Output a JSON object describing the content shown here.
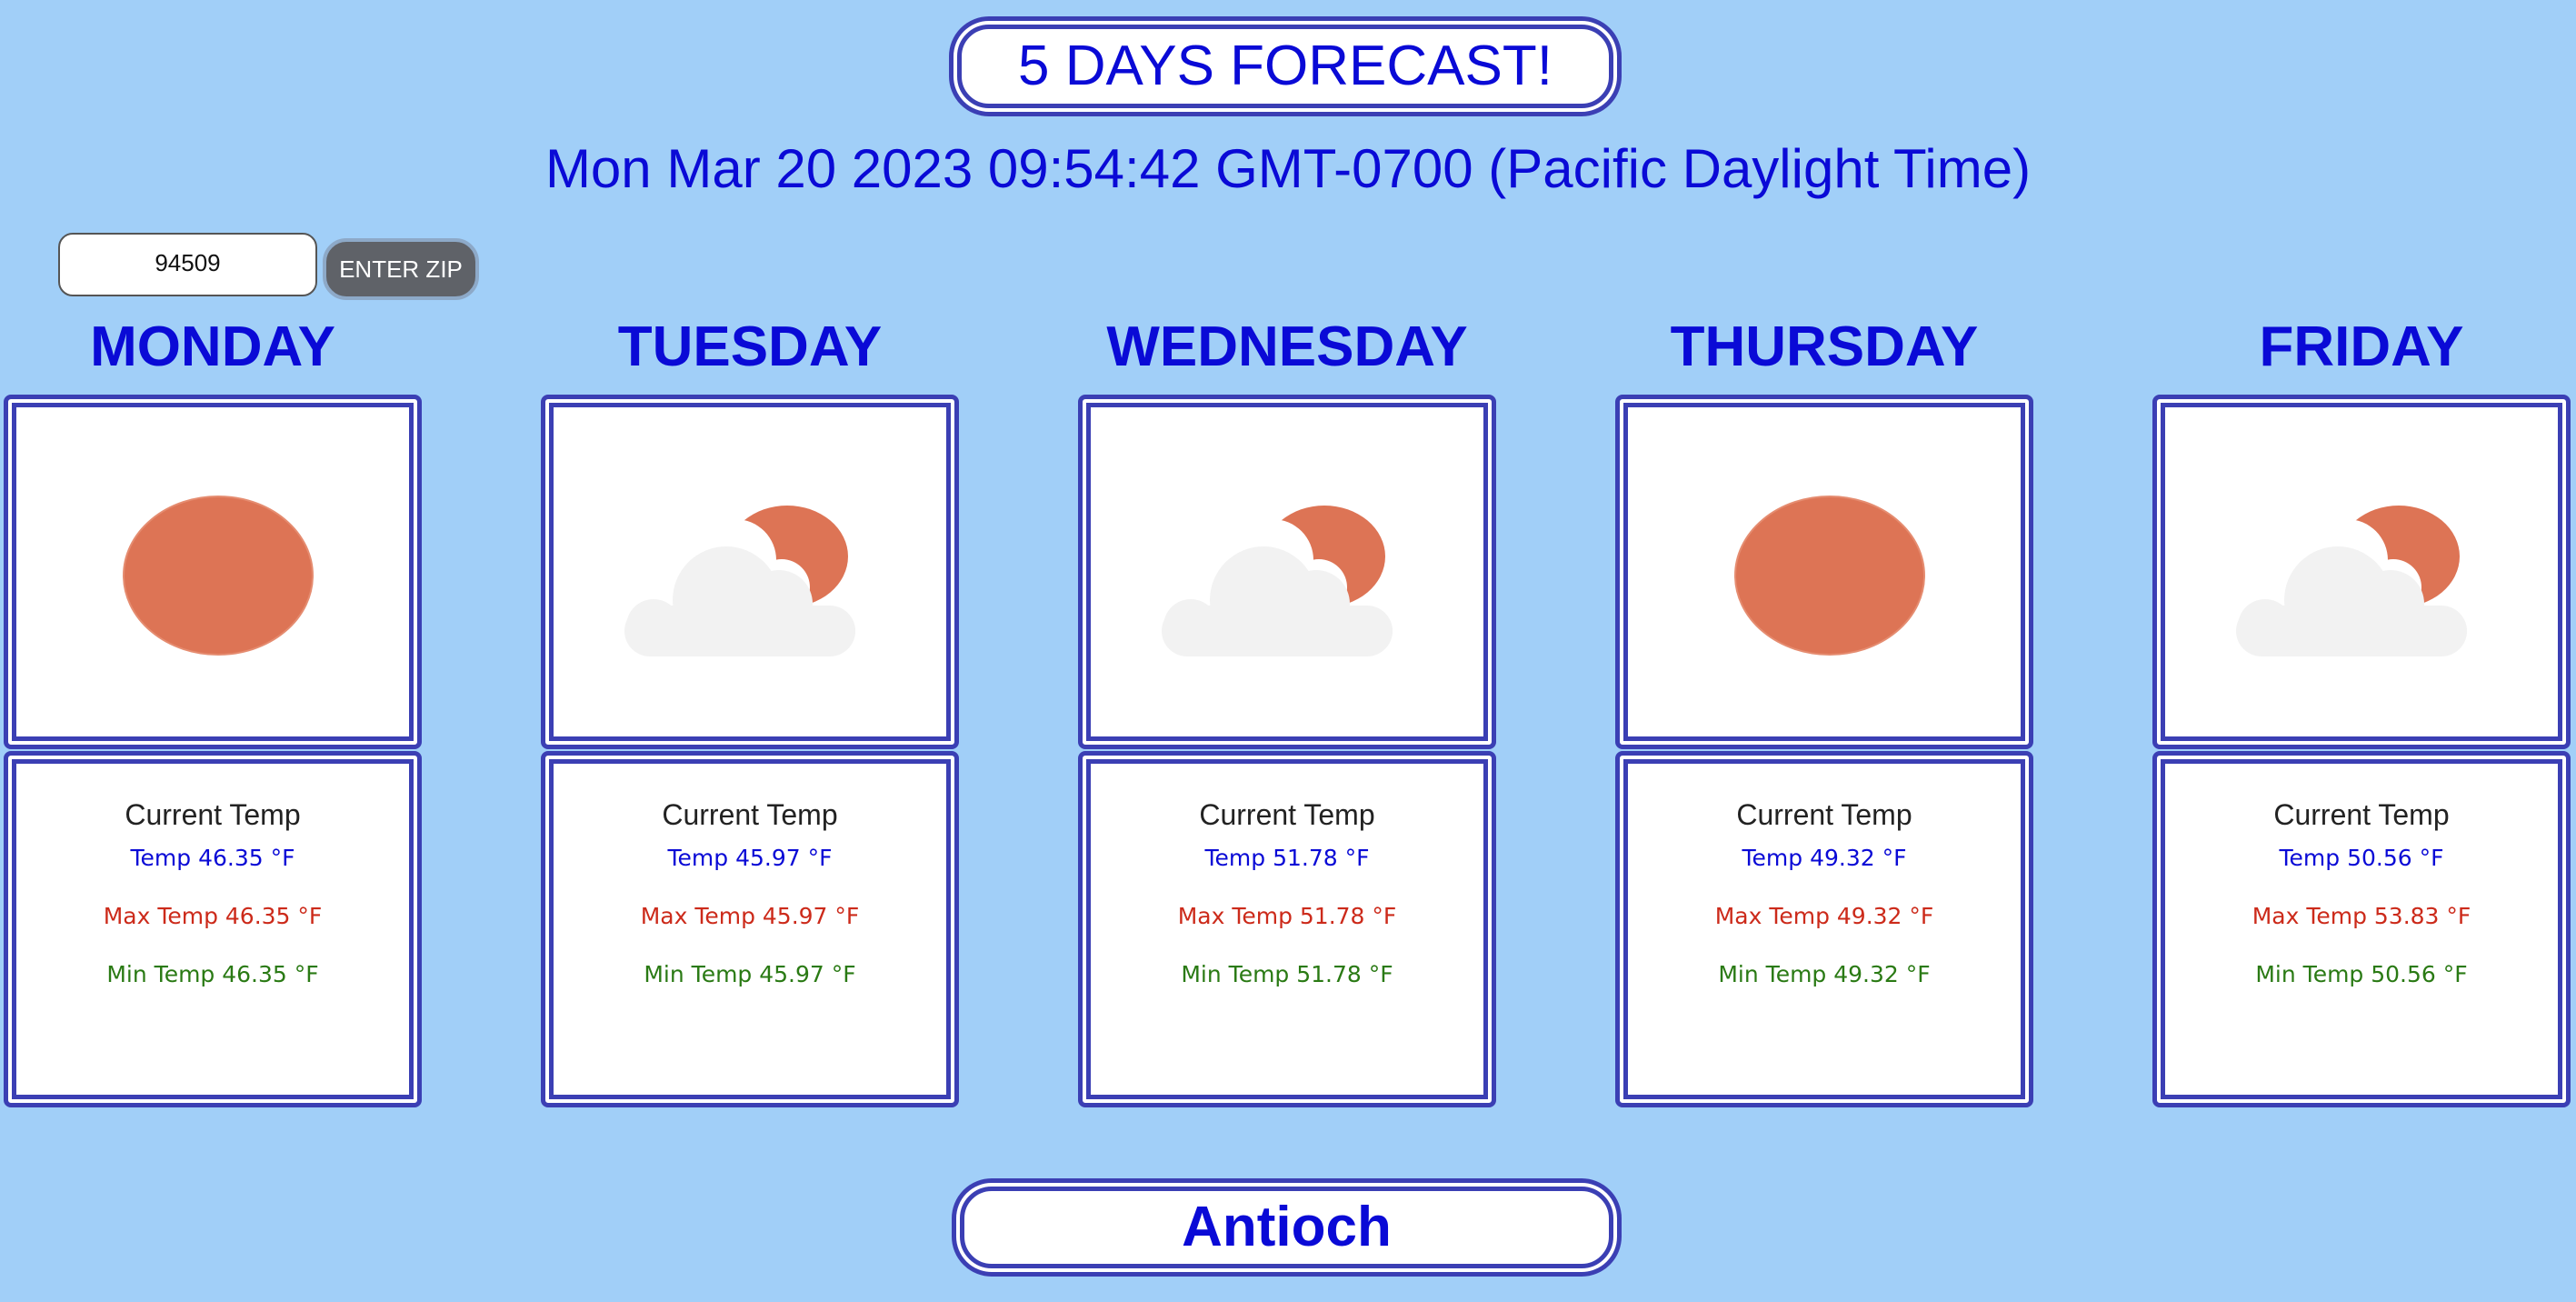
{
  "header": {
    "title": "5 DAYS FORECAST!",
    "datetime": "Mon Mar 20 2023 09:54:42 GMT-0700 (Pacific Daylight Time)"
  },
  "zip": {
    "value": "94509",
    "button_label": "ENTER ZIP"
  },
  "days": [
    {
      "name": "MONDAY",
      "icon": "sun-icon",
      "heading": "Current Temp",
      "temp": "Temp 46.35 °F",
      "max": "Max Temp 46.35 °F",
      "min": "Min Temp 46.35 °F"
    },
    {
      "name": "TUESDAY",
      "icon": "partly-cloudy-icon",
      "heading": "Current Temp",
      "temp": "Temp 45.97 °F",
      "max": "Max Temp 45.97 °F",
      "min": "Min Temp 45.97 °F"
    },
    {
      "name": "WEDNESDAY",
      "icon": "partly-cloudy-icon",
      "heading": "Current Temp",
      "temp": "Temp 51.78 °F",
      "max": "Max Temp 51.78 °F",
      "min": "Min Temp 51.78 °F"
    },
    {
      "name": "THURSDAY",
      "icon": "sun-icon",
      "heading": "Current Temp",
      "temp": "Temp 49.32 °F",
      "max": "Max Temp 49.32 °F",
      "min": "Min Temp 49.32 °F"
    },
    {
      "name": "FRIDAY",
      "icon": "partly-cloudy-icon",
      "heading": "Current Temp",
      "temp": "Temp 50.56 °F",
      "max": "Max Temp 53.83 °F",
      "min": "Min Temp 50.56 °F"
    }
  ],
  "city": "Antioch",
  "colors": {
    "background": "#a1cff8",
    "accent_text": "#0a0ad6",
    "border": "#3b3fb4",
    "sun": "#dd7455",
    "cloud": "#f2f2f2",
    "max_temp": "#cc2a1a",
    "min_temp": "#2a7a14"
  }
}
